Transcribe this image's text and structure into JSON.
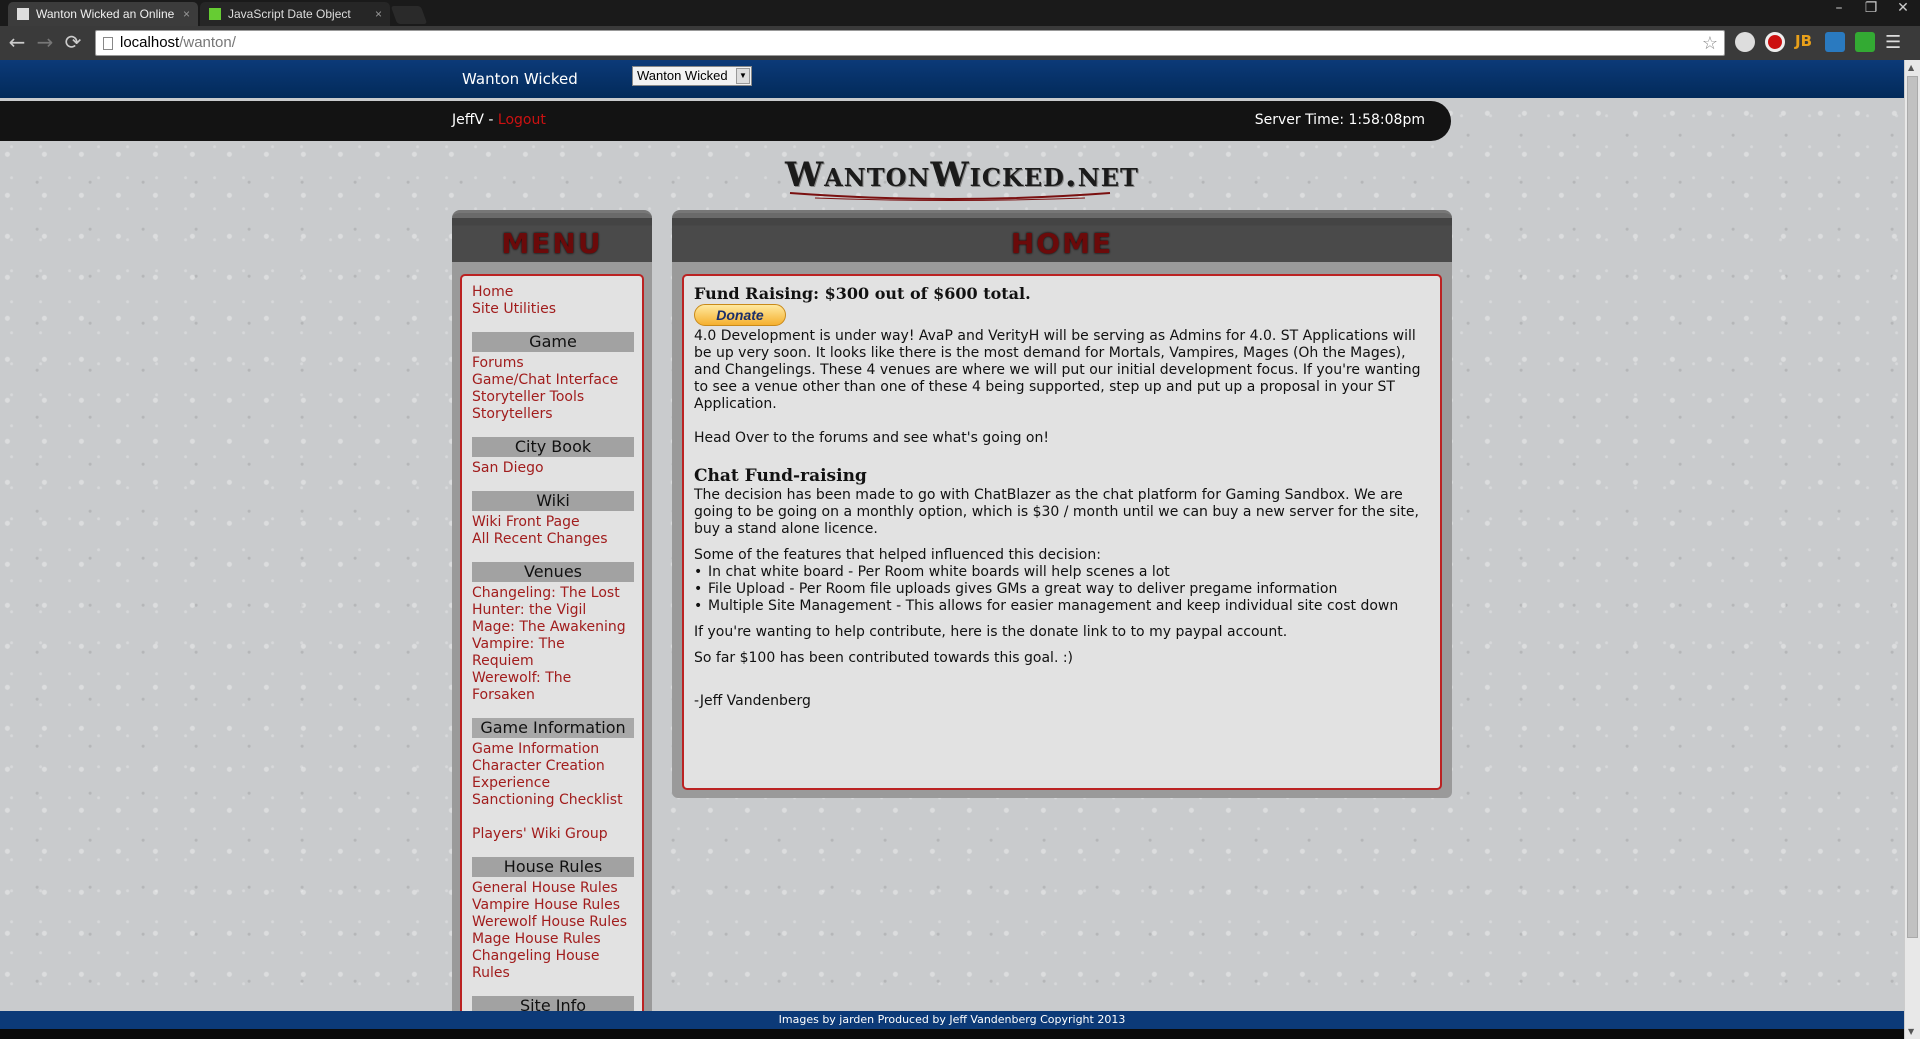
{
  "browser": {
    "tabs": [
      {
        "title": "Wanton Wicked an Online",
        "active": true
      },
      {
        "title": "JavaScript Date Object",
        "active": false
      }
    ],
    "url_host": "localhost",
    "url_path": "/wanton/",
    "window_controls": {
      "minimize": "–",
      "restore": "❐",
      "close": "✕"
    },
    "nav": {
      "back": "←",
      "forward": "→",
      "reload": "⟳"
    },
    "star": "☆",
    "menu": "☰"
  },
  "site": {
    "title": "Wanton Wicked",
    "selector_value": "Wanton Wicked",
    "user": "JeffV",
    "separator": " - ",
    "logout": "Logout",
    "server_time": "Server Time: 1:58:08pm",
    "logo": "WantonWicked.net"
  },
  "menu": {
    "heading": "MENU",
    "top_links": [
      "Home",
      "Site Utilities"
    ],
    "sections": [
      {
        "title": "Game",
        "links": [
          "Forums",
          "Game/Chat Interface",
          "Storyteller Tools",
          "Storytellers"
        ]
      },
      {
        "title": "City Book",
        "links": [
          "San Diego"
        ]
      },
      {
        "title": "Wiki",
        "links": [
          "Wiki Front Page",
          "All Recent Changes"
        ]
      },
      {
        "title": "Venues",
        "links": [
          "Changeling: The Lost",
          "Hunter: the Vigil",
          "Mage: The Awakening",
          "Vampire: The Requiem",
          "Werewolf: The Forsaken"
        ]
      },
      {
        "title": "Game Information",
        "links": [
          "Game Information",
          "Character Creation",
          "Experience",
          "Sanctioning Checklist"
        ],
        "extra": "Players' Wiki Group"
      },
      {
        "title": "House Rules",
        "links": [
          "General House Rules",
          "Vampire House Rules",
          "Werewolf House Rules",
          "Mage House Rules",
          "Changeling House Rules"
        ]
      },
      {
        "title": "Site Info",
        "links": []
      }
    ]
  },
  "home": {
    "heading": "HOME",
    "fund_title": "Fund Raising: $300 out of $600 total.",
    "donate": "Donate",
    "intro": "4.0 Development is under way! AvaP and VerityH will be serving as Admins for 4.0. ST Applications will be up very soon. It looks like there is the most demand for Mortals, Vampires, Mages (Oh the Mages), and Changelings. These 4 venues are where we will put our initial development focus. If you're wanting to see a venue other than one of these 4 being supported, step up and put up a proposal in your ST Application.",
    "forums_line": "Head Over to the forums and see what's going on!",
    "chat_title": "Chat Fund-raising",
    "chat_body": "The decision has been made to go with ChatBlazer as the chat platform for Gaming Sandbox. We are going to be going on a monthly option, which is $30 / month until we can buy a new server for the site, buy a stand alone licence.",
    "features_intro": "Some of the features that helped influenced this decision:",
    "features": [
      "In chat white board - Per Room white boards will help scenes a lot",
      "File Upload - Per Room file uploads gives GMs a great way to deliver pregame information",
      "Multiple Site Management - This allows for easier management and keep individual site cost down"
    ],
    "contribute": "If you're wanting to help contribute, here is the donate link to to my paypal account.",
    "so_far": "So far $100 has been contributed towards this goal. :)",
    "signature": "-Jeff Vandenberg"
  },
  "footer": "Images by jarden Produced by Jeff Vandenberg Copyright 2013",
  "colors": {
    "link": "#a11d1d",
    "site_bar": "#0c3a78",
    "panel_heading": "#6b0a0a",
    "box_border": "#bb2222"
  },
  "icons": [
    "page-icon",
    "star-icon",
    "chrome-menu-icon"
  ]
}
